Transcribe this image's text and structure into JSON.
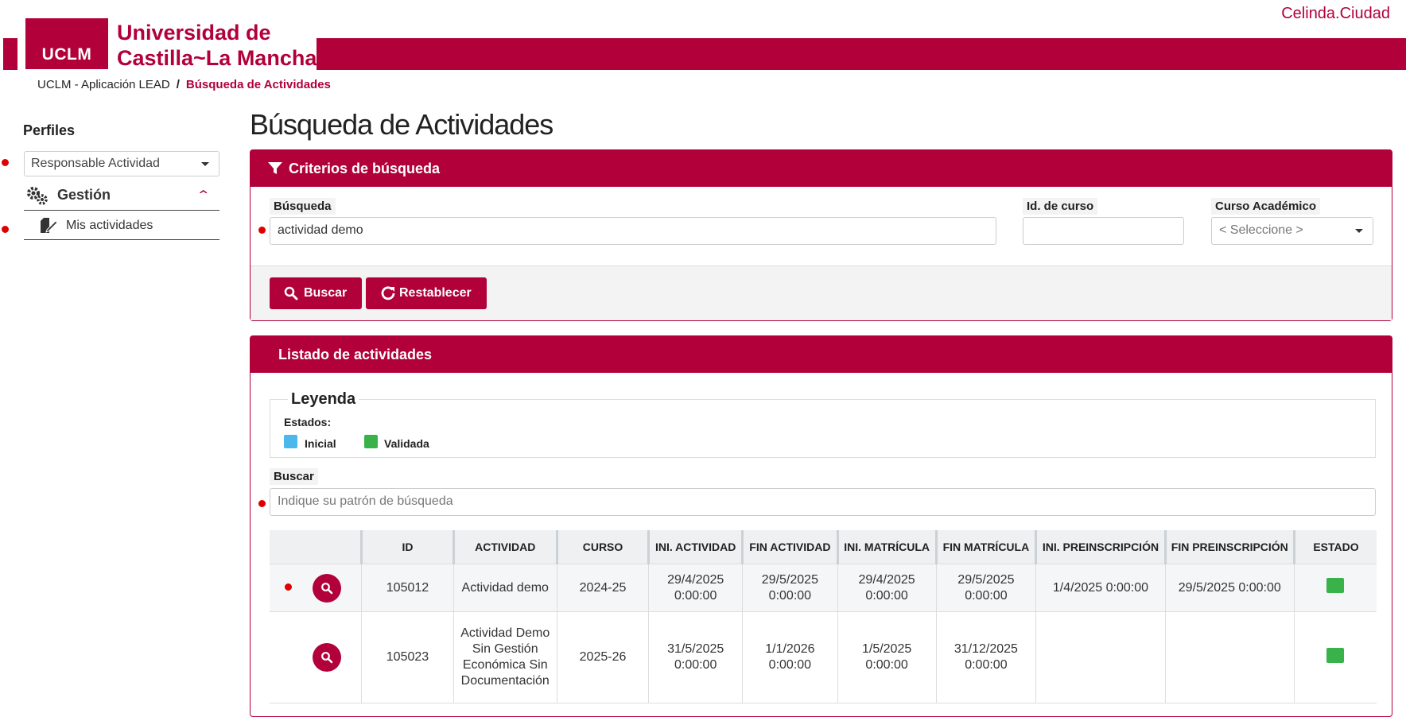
{
  "header": {
    "logo_text": "UCLM",
    "university_name": "Universidad de Castilla-La Mancha",
    "university_line1": "Universidad de",
    "university_line2": "Castilla~La Mancha",
    "user": "Celinda.Ciudad",
    "brand_color": "#b1003a"
  },
  "breadcrumb": {
    "root": "UCLM - Aplicación LEAD",
    "separator": "/",
    "current": "Búsqueda de Actividades"
  },
  "sidebar": {
    "title": "Perfiles",
    "profile_selected": "Responsable Actividad",
    "group_label": "Gestión",
    "items": [
      {
        "label": "Mis actividades",
        "icon": "edit-document-icon"
      }
    ]
  },
  "page": {
    "title": "Búsqueda de Actividades"
  },
  "search_card": {
    "title": "Criterios de búsqueda",
    "fields": {
      "busqueda_label": "Búsqueda",
      "busqueda_value": "actividad demo",
      "id_curso_label": "Id. de curso",
      "id_curso_value": "",
      "curso_label": "Curso Académico",
      "curso_value": "< Seleccione >"
    },
    "buttons": {
      "search": "Buscar",
      "reset": "Restablecer"
    }
  },
  "list_card": {
    "title": "Listado de actividades",
    "legend": {
      "title": "Leyenda",
      "states_label": "Estados:",
      "states": [
        {
          "label": "Inicial",
          "color": "#4ab8ea"
        },
        {
          "label": "Validada",
          "color": "#3ab24a"
        }
      ]
    },
    "filter": {
      "label": "Buscar",
      "placeholder": "Indique su patrón de búsqueda"
    },
    "table": {
      "columns": [
        "",
        "ID",
        "ACTIVIDAD",
        "CURSO",
        "INI. ACTIVIDAD",
        "FIN ACTIVIDAD",
        "INI. MATRÍCULA",
        "FIN MATRÍCULA",
        "INI. PREINSCRIPCIÓN",
        "FIN PREINSCRIPCIÓN",
        "ESTADO"
      ],
      "rows": [
        {
          "id": "105012",
          "actividad": "Actividad demo",
          "curso": "2024-25",
          "ini_actividad": "29/4/2025 0:00:00",
          "fin_actividad": "29/5/2025 0:00:00",
          "ini_matricula": "29/4/2025 0:00:00",
          "fin_matricula": "29/5/2025 0:00:00",
          "ini_preinscripcion": "1/4/2025 0:00:00",
          "fin_preinscripcion": "29/5/2025 0:00:00",
          "estado": "Validada"
        },
        {
          "id": "105023",
          "actividad": "Actividad Demo Sin Gestión Económica Sin Documentación",
          "curso": "2025-26",
          "ini_actividad": "31/5/2025 0:00:00",
          "fin_actividad": "1/1/2026 0:00:00",
          "ini_matricula": "1/5/2025 0:00:00",
          "fin_matricula": "31/12/2025 0:00:00",
          "ini_preinscripcion": "",
          "fin_preinscripcion": "",
          "estado": "Validada"
        }
      ]
    }
  }
}
